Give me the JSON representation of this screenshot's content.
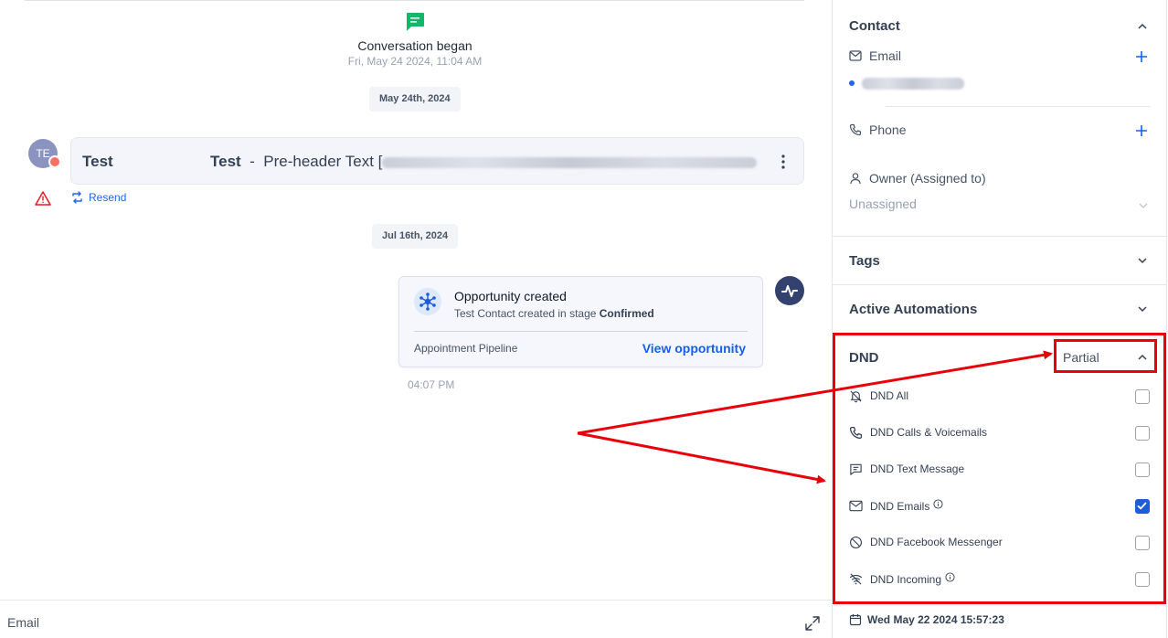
{
  "conversation": {
    "began_title": "Conversation began",
    "began_time": "Fri, May 24 2024, 11:04 AM",
    "date_chip_1": "May 24th, 2024",
    "date_chip_2": "Jul 16th, 2024",
    "avatar_initials": "TE",
    "email_subject": "Test",
    "email_subject_2": "Test",
    "email_separator": "-",
    "email_preview": "Pre-header Text [",
    "resend_label": "Resend",
    "opportunity": {
      "title": "Opportunity created",
      "subtitle_prefix": "Test Contact created in stage",
      "stage": "Confirmed",
      "pipeline": "Appointment Pipeline",
      "link_label": "View opportunity",
      "time": "04:07 PM"
    },
    "composer_channel": "Email"
  },
  "panel": {
    "contact": {
      "title": "Contact",
      "email_label": "Email",
      "phone_label": "Phone",
      "owner_label": "Owner (Assigned to)",
      "owner_value": "Unassigned"
    },
    "tags_title": "Tags",
    "automations_title": "Active Automations",
    "dnd": {
      "title": "DND",
      "status": "Partial",
      "items": [
        {
          "label": "DND All",
          "icon": "bell-off-icon",
          "checked": false
        },
        {
          "label": "DND Calls & Voicemails",
          "icon": "phone-icon",
          "checked": false
        },
        {
          "label": "DND Text Message",
          "icon": "message-icon",
          "checked": false
        },
        {
          "label": "DND Emails",
          "icon": "mail-icon",
          "checked": true,
          "info": true
        },
        {
          "label": "DND Facebook Messenger",
          "icon": "block-icon",
          "checked": false
        },
        {
          "label": "DND Incoming",
          "icon": "wifi-off-icon",
          "checked": false,
          "info": true
        }
      ]
    },
    "footer_date": "Wed May 22 2024 15:57:23"
  },
  "colors": {
    "accent": "#155eef",
    "annotation": "#e8000b",
    "checkbox_checked": "#1d5dd8",
    "chat_icon": "#12b76a"
  }
}
